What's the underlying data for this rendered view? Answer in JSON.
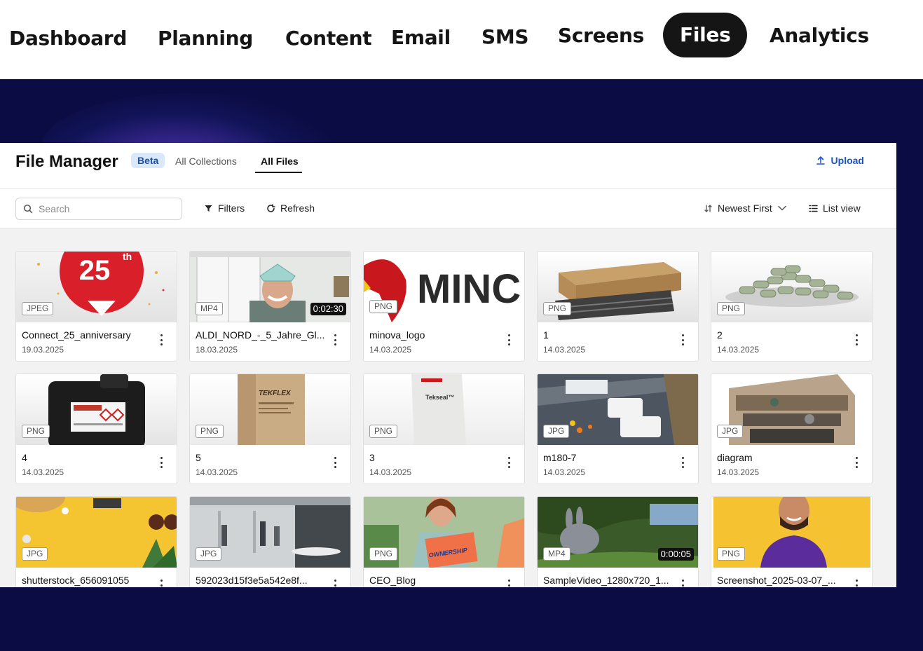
{
  "nav": {
    "items": [
      {
        "label": "Dashboard"
      },
      {
        "label": "Planning"
      },
      {
        "label": "Content"
      },
      {
        "label": "Email"
      },
      {
        "label": "SMS"
      },
      {
        "label": "Screens"
      },
      {
        "label": "Files",
        "active": true
      },
      {
        "label": "Analytics"
      }
    ]
  },
  "file_manager": {
    "title": "File Manager",
    "beta_label": "Beta",
    "tabs": [
      {
        "label": "All Collections"
      },
      {
        "label": "All Files",
        "active": true
      }
    ],
    "upload_label": "Upload",
    "search_placeholder": "Search",
    "filters_label": "Filters",
    "refresh_label": "Refresh",
    "sort_label": "Newest First",
    "view_label": "List view"
  },
  "files": [
    {
      "name": "Connect_25_anniversary",
      "date": "19.03.2025",
      "type": "JPEG",
      "thumb": "anniversary"
    },
    {
      "name": "ALDI_NORD_-_5_Jahre_Gl...",
      "date": "18.03.2025",
      "type": "MP4",
      "duration": "0:02:30",
      "thumb": "person-window"
    },
    {
      "name": "minova_logo",
      "date": "14.03.2025",
      "type": "PNG",
      "thumb": "minova-logo"
    },
    {
      "name": "1",
      "date": "14.03.2025",
      "type": "PNG",
      "thumb": "box-rods"
    },
    {
      "name": "2",
      "date": "14.03.2025",
      "type": "PNG",
      "thumb": "pellets"
    },
    {
      "name": "4",
      "date": "14.03.2025",
      "type": "PNG",
      "thumb": "canister"
    },
    {
      "name": "5",
      "date": "14.03.2025",
      "type": "PNG",
      "thumb": "tekflex-bag"
    },
    {
      "name": "3",
      "date": "14.03.2025",
      "type": "PNG",
      "thumb": "tekseal-bag"
    },
    {
      "name": "m180-7",
      "date": "14.03.2025",
      "type": "JPG",
      "thumb": "road-vans"
    },
    {
      "name": "diagram",
      "date": "14.03.2025",
      "type": "JPG",
      "thumb": "cutaway"
    },
    {
      "name": "shutterstock_656091055",
      "date": "",
      "type": "JPG",
      "thumb": "yellow-flatlay"
    },
    {
      "name": "592023d15f3e5a542e8f...",
      "date": "",
      "type": "JPG",
      "thumb": "office"
    },
    {
      "name": "CEO_Blog",
      "date": "",
      "type": "PNG",
      "thumb": "ownership"
    },
    {
      "name": "SampleVideo_1280x720_1...",
      "date": "",
      "type": "MP4",
      "duration": "0:00:05",
      "thumb": "bunny"
    },
    {
      "name": "Screenshot_2025-03-07_...",
      "date": "",
      "type": "PNG",
      "thumb": "man-yellow"
    }
  ],
  "thumbnail_text": {
    "anniversary_number": "25",
    "anniversary_suffix": "th",
    "logo_text": "MINC",
    "tekflex_text": "TEKFLEX",
    "tekseal_text": "Tekseal™",
    "ownership_text": "OWNERSHIP"
  },
  "colors": {
    "background": "#0c0c45",
    "accent": "#1a56c4",
    "nav_active": "#151515"
  }
}
